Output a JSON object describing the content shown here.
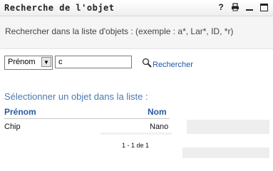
{
  "window": {
    "title": "Recherche de l'objet",
    "icons": [
      "help-icon",
      "print-icon",
      "minimize-icon",
      "maximize-icon"
    ],
    "help_glyph": "?",
    "print_glyph": "⎙",
    "minimize_glyph": "▁",
    "maximize_glyph": "□"
  },
  "instructions": "Rechercher dans la liste d'objets : (exemple : a*, Lar*, ID, *r)",
  "search": {
    "field_selected": "Prénom",
    "query_value": "c",
    "button_label": "Rechercher"
  },
  "results": {
    "label": "Sélectionner un objet dans la liste :",
    "columns": [
      "Prénom",
      "Nom"
    ],
    "rows": [
      {
        "prenom": "Chip",
        "nom": "Nano"
      }
    ],
    "pager": "1 - 1 de 1"
  },
  "colors": {
    "link": "#2255aa",
    "header": "#2a5aa0",
    "label": "#4a7ab0"
  }
}
